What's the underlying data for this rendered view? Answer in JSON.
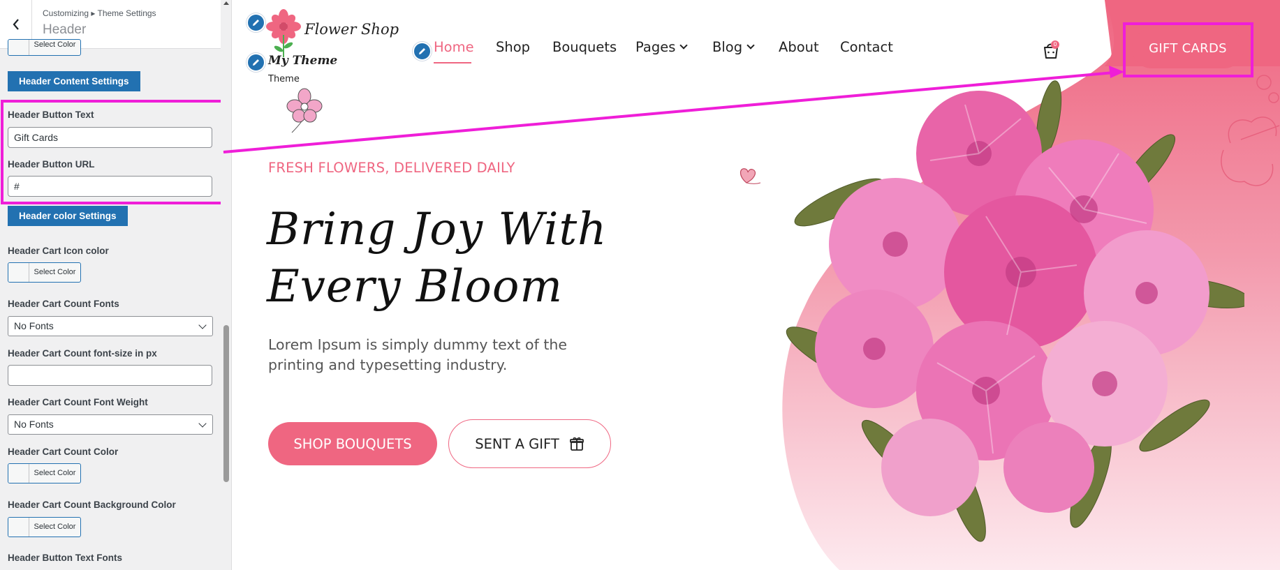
{
  "customizer": {
    "breadcrumb": "Customizing ▸ Theme Settings",
    "section_title": "Header",
    "cut_off_button": "Select Color",
    "content_settings_button": "Header Content Settings",
    "button_text_label": "Header Button Text",
    "button_text_value": "Gift Cards",
    "button_url_label": "Header Button URL",
    "button_url_value": "#",
    "color_settings_button": "Header color Settings",
    "cart_icon_color_label": "Header Cart Icon color",
    "select_color": "Select Color",
    "cart_count_fonts_label": "Header Cart Count Fonts",
    "cart_count_fonts_value": "No Fonts",
    "cart_count_size_label": "Header Cart Count font-size in px",
    "cart_count_size_value": "",
    "cart_count_weight_label": "Header Cart Count Font Weight",
    "cart_count_weight_value": "No Fonts",
    "cart_count_color_label": "Header Cart Count Color",
    "cart_count_bg_label": "Header Cart Count Background Color",
    "button_text_fonts_label": "Header Button Text Fonts"
  },
  "site": {
    "brand_name": "Flower Shop",
    "site_title": "My Theme",
    "tagline": "Theme",
    "nav": {
      "home": "Home",
      "shop": "Shop",
      "bouquets": "Bouquets",
      "pages": "Pages",
      "blog": "Blog",
      "about": "About",
      "contact": "Contact"
    },
    "cart_count": "0",
    "header_button": "GIFT CARDS",
    "hero": {
      "eyebrow": "FRESH FLOWERS, DELIVERED DAILY",
      "title": "Bring Joy With Every Bloom",
      "subtitle": "Lorem Ipsum is simply dummy text of the printing and typesetting industry.",
      "primary_button": "SHOP BOUQUETS",
      "secondary_button": "SENT A GIFT"
    }
  },
  "colors": {
    "accent": "#ef6681",
    "highlight": "#ef1ed8",
    "wp_blue": "#2271b1"
  }
}
